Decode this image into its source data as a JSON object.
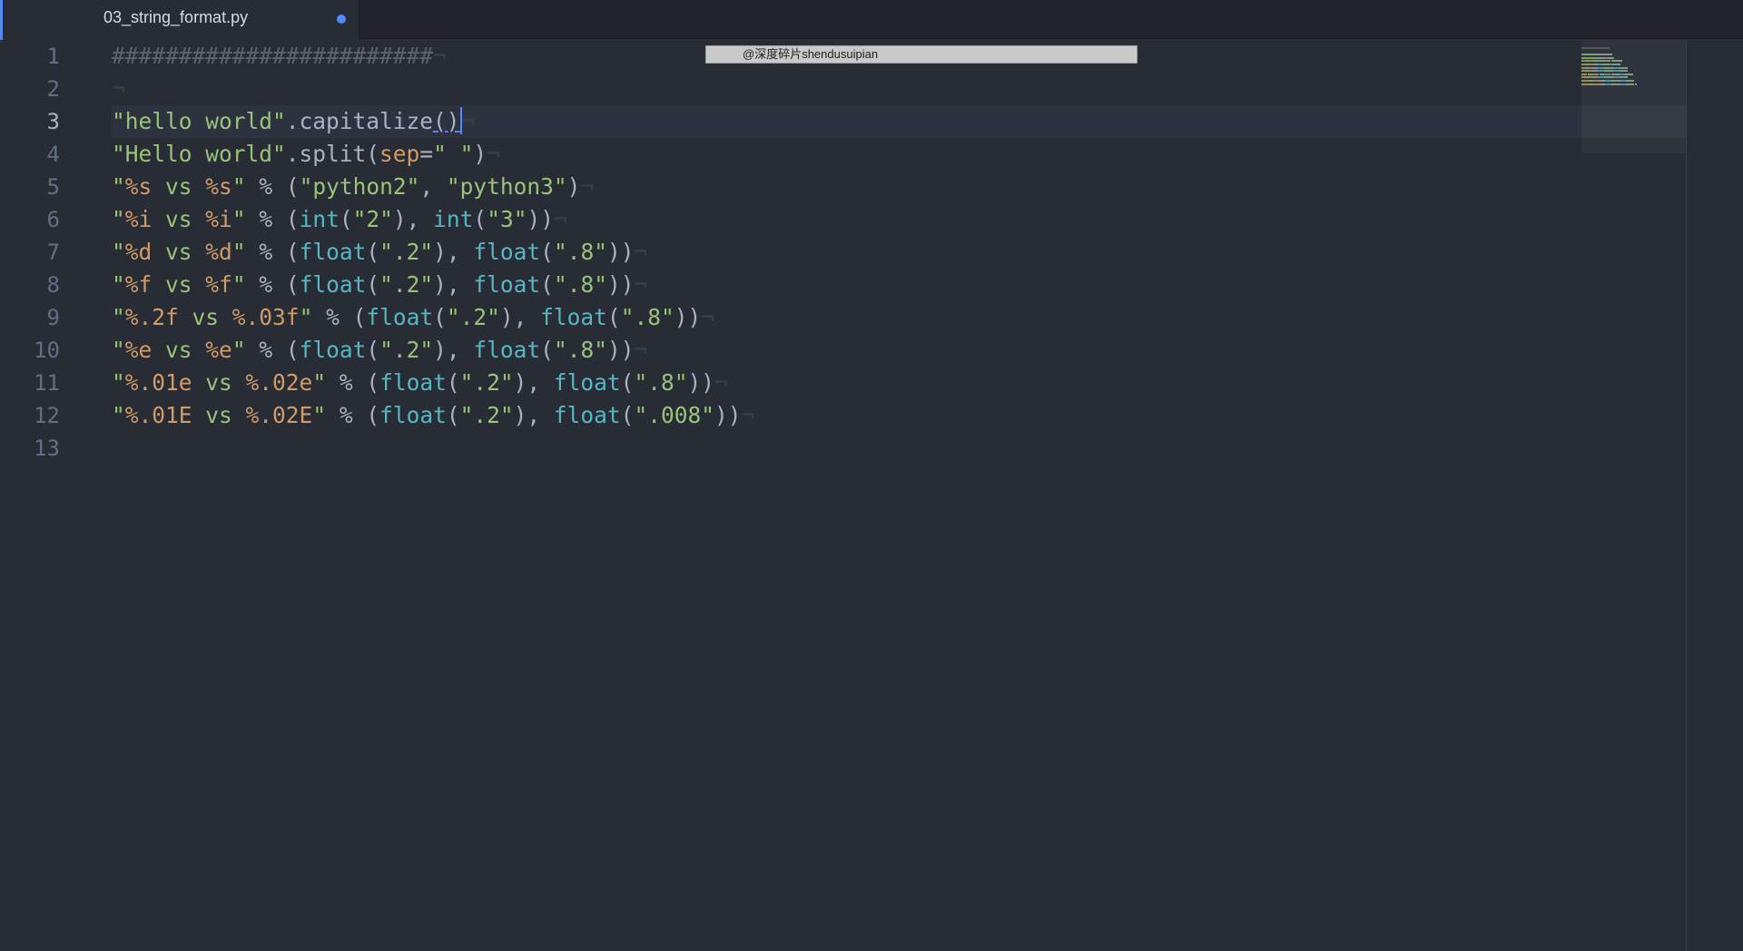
{
  "tab": {
    "title": "03_string_format.py",
    "modified": true
  },
  "watermark": "@深度碎片shendusuipian",
  "editor": {
    "active_line": 3,
    "line_numbers": [
      "1",
      "2",
      "3",
      "4",
      "5",
      "6",
      "7",
      "8",
      "9",
      "10",
      "11",
      "12",
      "13"
    ],
    "eol_marker": "¬",
    "lines": [
      [
        {
          "t": "########################",
          "c": "comment"
        }
      ],
      [],
      [
        {
          "t": "\"hello world\"",
          "c": "str"
        },
        {
          "t": ".capitalize",
          "c": "plain"
        },
        {
          "t": "()",
          "c": "bracket"
        }
      ],
      [
        {
          "t": "\"Hello world\"",
          "c": "str"
        },
        {
          "t": ".split(",
          "c": "plain"
        },
        {
          "t": "sep",
          "c": "fmt"
        },
        {
          "t": "=",
          "c": "plain"
        },
        {
          "t": "\" \"",
          "c": "str"
        },
        {
          "t": ")",
          "c": "plain"
        }
      ],
      [
        {
          "t": "\"",
          "c": "str"
        },
        {
          "t": "%s",
          "c": "fmt"
        },
        {
          "t": " vs ",
          "c": "str"
        },
        {
          "t": "%s",
          "c": "fmt"
        },
        {
          "t": "\"",
          "c": "str"
        },
        {
          "t": " % (",
          "c": "plain"
        },
        {
          "t": "\"python2\"",
          "c": "str"
        },
        {
          "t": ", ",
          "c": "plain"
        },
        {
          "t": "\"python3\"",
          "c": "str"
        },
        {
          "t": ")",
          "c": "plain"
        }
      ],
      [
        {
          "t": "\"",
          "c": "str"
        },
        {
          "t": "%i",
          "c": "fmt"
        },
        {
          "t": " vs ",
          "c": "str"
        },
        {
          "t": "%i",
          "c": "fmt"
        },
        {
          "t": "\"",
          "c": "str"
        },
        {
          "t": " % (",
          "c": "plain"
        },
        {
          "t": "int",
          "c": "func"
        },
        {
          "t": "(",
          "c": "plain"
        },
        {
          "t": "\"2\"",
          "c": "str"
        },
        {
          "t": "), ",
          "c": "plain"
        },
        {
          "t": "int",
          "c": "func"
        },
        {
          "t": "(",
          "c": "plain"
        },
        {
          "t": "\"3\"",
          "c": "str"
        },
        {
          "t": "))",
          "c": "plain"
        }
      ],
      [
        {
          "t": "\"",
          "c": "str"
        },
        {
          "t": "%d",
          "c": "fmt"
        },
        {
          "t": " vs ",
          "c": "str"
        },
        {
          "t": "%d",
          "c": "fmt"
        },
        {
          "t": "\"",
          "c": "str"
        },
        {
          "t": " % (",
          "c": "plain"
        },
        {
          "t": "float",
          "c": "func"
        },
        {
          "t": "(",
          "c": "plain"
        },
        {
          "t": "\".2\"",
          "c": "str"
        },
        {
          "t": "), ",
          "c": "plain"
        },
        {
          "t": "float",
          "c": "func"
        },
        {
          "t": "(",
          "c": "plain"
        },
        {
          "t": "\".8\"",
          "c": "str"
        },
        {
          "t": "))",
          "c": "plain"
        }
      ],
      [
        {
          "t": "\"",
          "c": "str"
        },
        {
          "t": "%f",
          "c": "fmt"
        },
        {
          "t": " vs ",
          "c": "str"
        },
        {
          "t": "%f",
          "c": "fmt"
        },
        {
          "t": "\"",
          "c": "str"
        },
        {
          "t": " % (",
          "c": "plain"
        },
        {
          "t": "float",
          "c": "func"
        },
        {
          "t": "(",
          "c": "plain"
        },
        {
          "t": "\".2\"",
          "c": "str"
        },
        {
          "t": "), ",
          "c": "plain"
        },
        {
          "t": "float",
          "c": "func"
        },
        {
          "t": "(",
          "c": "plain"
        },
        {
          "t": "\".8\"",
          "c": "str"
        },
        {
          "t": "))",
          "c": "plain"
        }
      ],
      [
        {
          "t": "\"",
          "c": "str"
        },
        {
          "t": "%.2f",
          "c": "fmt"
        },
        {
          "t": " vs ",
          "c": "str"
        },
        {
          "t": "%.03f",
          "c": "fmt"
        },
        {
          "t": "\"",
          "c": "str"
        },
        {
          "t": " % (",
          "c": "plain"
        },
        {
          "t": "float",
          "c": "func"
        },
        {
          "t": "(",
          "c": "plain"
        },
        {
          "t": "\".2\"",
          "c": "str"
        },
        {
          "t": "), ",
          "c": "plain"
        },
        {
          "t": "float",
          "c": "func"
        },
        {
          "t": "(",
          "c": "plain"
        },
        {
          "t": "\".8\"",
          "c": "str"
        },
        {
          "t": "))",
          "c": "plain"
        }
      ],
      [
        {
          "t": "\"",
          "c": "str"
        },
        {
          "t": "%e",
          "c": "fmt"
        },
        {
          "t": " vs ",
          "c": "str"
        },
        {
          "t": "%e",
          "c": "fmt"
        },
        {
          "t": "\"",
          "c": "str"
        },
        {
          "t": " % (",
          "c": "plain"
        },
        {
          "t": "float",
          "c": "func"
        },
        {
          "t": "(",
          "c": "plain"
        },
        {
          "t": "\".2\"",
          "c": "str"
        },
        {
          "t": "), ",
          "c": "plain"
        },
        {
          "t": "float",
          "c": "func"
        },
        {
          "t": "(",
          "c": "plain"
        },
        {
          "t": "\".8\"",
          "c": "str"
        },
        {
          "t": "))",
          "c": "plain"
        }
      ],
      [
        {
          "t": "\"",
          "c": "str"
        },
        {
          "t": "%.01e",
          "c": "fmt"
        },
        {
          "t": " vs ",
          "c": "str"
        },
        {
          "t": "%.02e",
          "c": "fmt"
        },
        {
          "t": "\"",
          "c": "str"
        },
        {
          "t": " % (",
          "c": "plain"
        },
        {
          "t": "float",
          "c": "func"
        },
        {
          "t": "(",
          "c": "plain"
        },
        {
          "t": "\".2\"",
          "c": "str"
        },
        {
          "t": "), ",
          "c": "plain"
        },
        {
          "t": "float",
          "c": "func"
        },
        {
          "t": "(",
          "c": "plain"
        },
        {
          "t": "\".8\"",
          "c": "str"
        },
        {
          "t": "))",
          "c": "plain"
        }
      ],
      [
        {
          "t": "\"",
          "c": "str"
        },
        {
          "t": "%.01E",
          "c": "fmt"
        },
        {
          "t": " vs ",
          "c": "str"
        },
        {
          "t": "%.02E",
          "c": "fmt"
        },
        {
          "t": "\"",
          "c": "str"
        },
        {
          "t": " % (",
          "c": "plain"
        },
        {
          "t": "float",
          "c": "func"
        },
        {
          "t": "(",
          "c": "plain"
        },
        {
          "t": "\".2\"",
          "c": "str"
        },
        {
          "t": "), ",
          "c": "plain"
        },
        {
          "t": "float",
          "c": "func"
        },
        {
          "t": "(",
          "c": "plain"
        },
        {
          "t": "\".008\"",
          "c": "str"
        },
        {
          "t": "))",
          "c": "plain"
        }
      ],
      []
    ]
  },
  "colors": {
    "background": "#282c34",
    "string": "#98c379",
    "format_spec": "#d19a66",
    "function": "#56b6c2",
    "plain": "#abb2bf",
    "comment": "#5c6370",
    "accent": "#528bff"
  }
}
